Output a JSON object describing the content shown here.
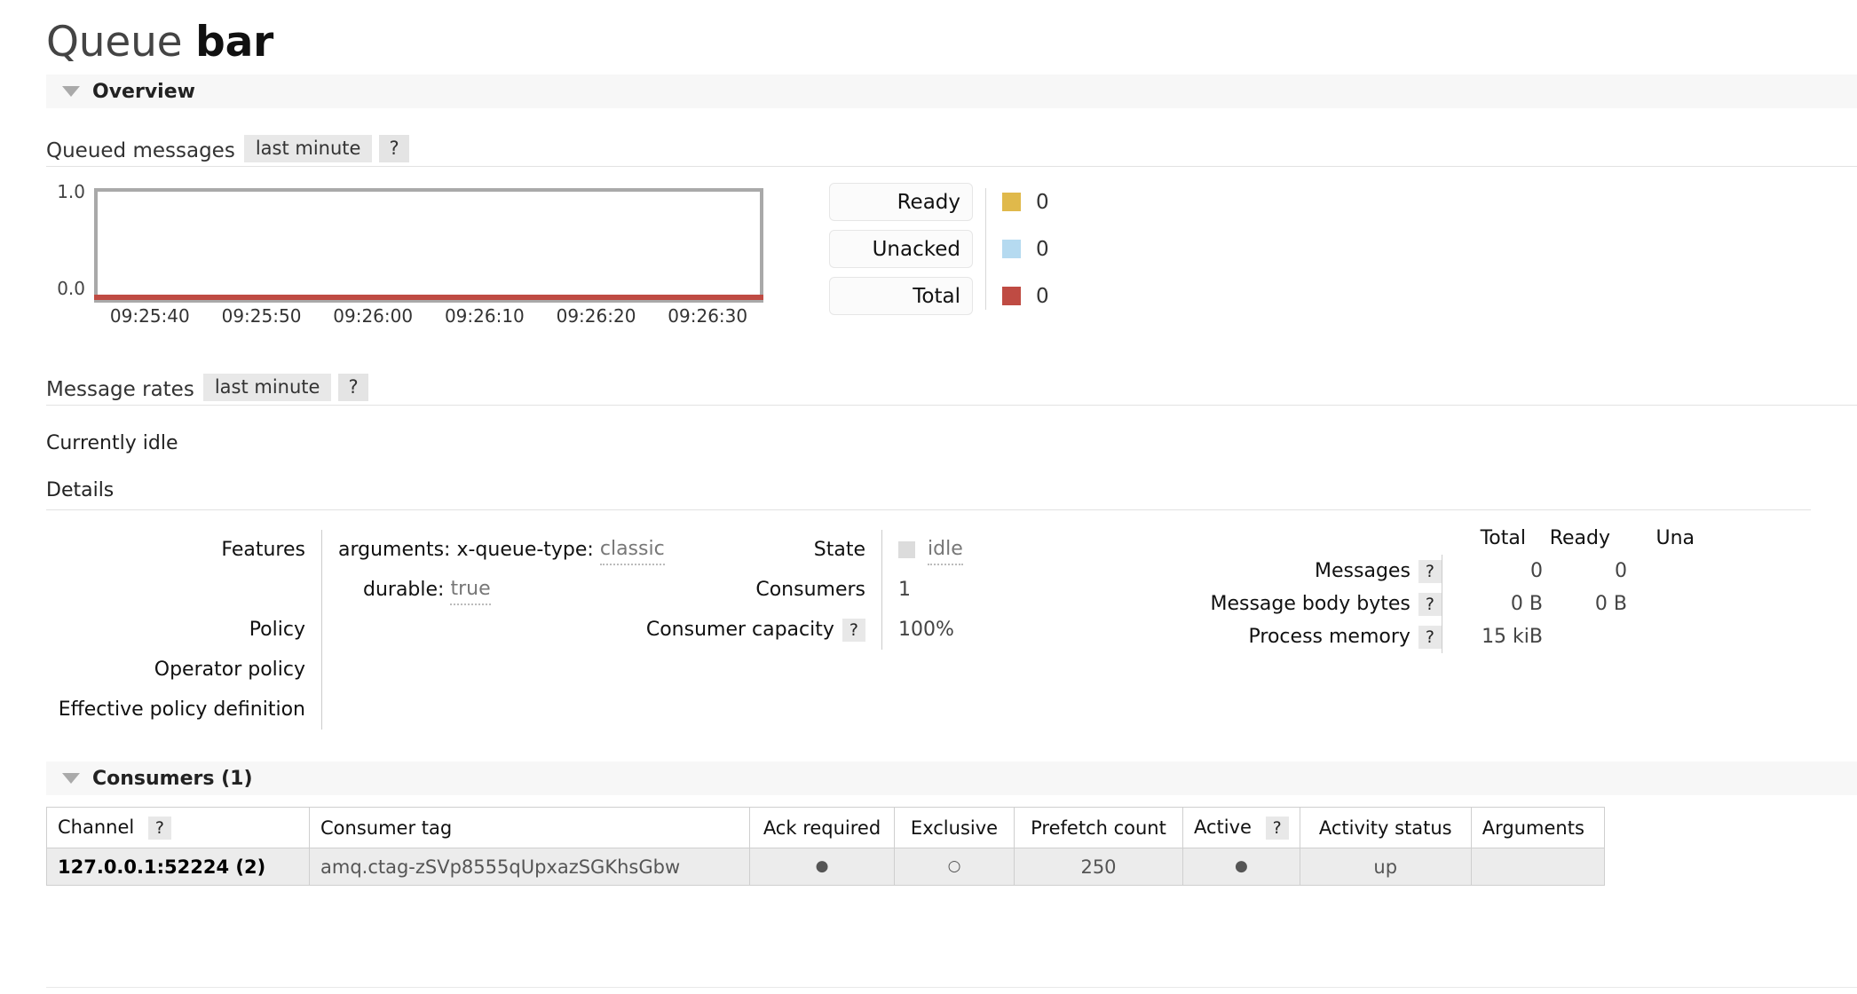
{
  "header": {
    "title_prefix": "Queue",
    "queue_name": "bar"
  },
  "overview": {
    "label": "Overview",
    "collapse_icon": "triangle-down-icon"
  },
  "queued_messages": {
    "label": "Queued messages",
    "period": "last minute",
    "help": "?",
    "legend": [
      {
        "name": "Ready",
        "value": "0",
        "color": "#e0b94b"
      },
      {
        "name": "Unacked",
        "value": "0",
        "color": "#b5daf0"
      },
      {
        "name": "Total",
        "value": "0",
        "color": "#bf4b43"
      }
    ]
  },
  "chart_data": {
    "type": "line",
    "title": "Queued messages",
    "xlabel": "",
    "ylabel": "",
    "ylim": [
      0.0,
      1.0
    ],
    "ytick_labels": [
      "1.0",
      "0.0"
    ],
    "x": [
      "09:25:40",
      "09:25:50",
      "09:26:00",
      "09:26:10",
      "09:26:20",
      "09:26:30"
    ],
    "grid": false,
    "legend_position": "right",
    "series": [
      {
        "name": "Ready",
        "color": "#e0b94b",
        "values": [
          0,
          0,
          0,
          0,
          0,
          0
        ]
      },
      {
        "name": "Unacked",
        "color": "#b5daf0",
        "values": [
          0,
          0,
          0,
          0,
          0,
          0
        ]
      },
      {
        "name": "Total",
        "color": "#bf4b43",
        "values": [
          0,
          0,
          0,
          0,
          0,
          0
        ]
      }
    ]
  },
  "message_rates": {
    "label": "Message rates",
    "period": "last minute",
    "help": "?",
    "status": "Currently idle"
  },
  "details": {
    "label": "Details",
    "features": {
      "keys": [
        "Features",
        "",
        "Policy",
        "Operator policy",
        "Effective policy definition"
      ],
      "rows": [
        {
          "key": "arguments:",
          "value_key": "x-queue-type:",
          "value": "classic"
        },
        {
          "key": "durable:",
          "value": "true"
        }
      ]
    },
    "state_col": {
      "rows": [
        {
          "key": "State",
          "help": "",
          "value": "idle",
          "indicator": "gray"
        },
        {
          "key": "Consumers",
          "help": "",
          "value": "1"
        },
        {
          "key": "Consumer capacity",
          "help": "?",
          "value": "100%"
        }
      ]
    },
    "numbers": {
      "columns": [
        "Total",
        "Ready",
        "Una"
      ],
      "rows": [
        {
          "key": "Messages",
          "help": "?",
          "values": [
            "0",
            "0",
            ""
          ]
        },
        {
          "key": "Message body bytes",
          "help": "?",
          "values": [
            "0 B",
            "0 B",
            ""
          ]
        },
        {
          "key": "Process memory",
          "help": "?",
          "values": [
            "15 kiB",
            "",
            ""
          ]
        }
      ]
    }
  },
  "consumers": {
    "label": "Consumers (1)",
    "collapse_icon": "triangle-down-icon",
    "columns": [
      {
        "label": "Channel",
        "help": "?"
      },
      {
        "label": "Consumer tag",
        "help": ""
      },
      {
        "label": "Ack required",
        "help": ""
      },
      {
        "label": "Exclusive",
        "help": ""
      },
      {
        "label": "Prefetch count",
        "help": ""
      },
      {
        "label": "Active",
        "help": "?"
      },
      {
        "label": "Activity status",
        "help": ""
      },
      {
        "label": "Arguments",
        "help": ""
      }
    ],
    "rows": [
      {
        "channel": "127.0.0.1:52224 (2)",
        "consumer_tag": "amq.ctag-zSVp8555qUpxazSGKhsGbw",
        "ack_required": "●",
        "exclusive": "○",
        "prefetch_count": "250",
        "active": "●",
        "activity_status": "up",
        "arguments": ""
      }
    ]
  }
}
